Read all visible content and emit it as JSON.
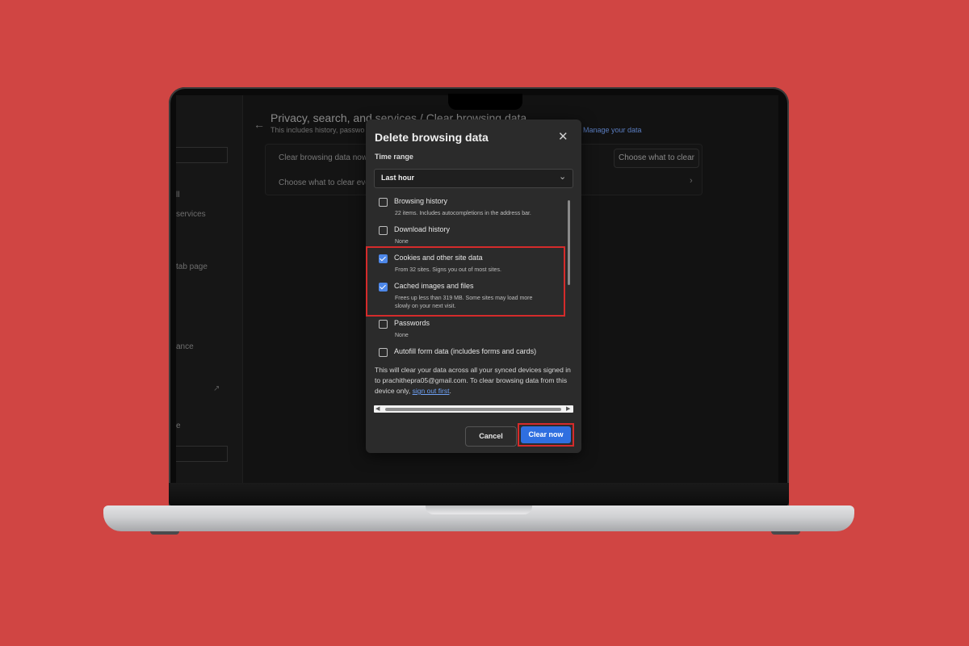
{
  "settings": {
    "page_title": "Privacy, search, and services / Clear browsing data",
    "page_subtitle": "This includes history, passwo",
    "manage_link": "Manage your data",
    "clear_now_row": "Clear browsing data now",
    "choose_every_row": "Choose what to clear ever",
    "choose_button": "Choose what to clear",
    "sidebar_items": [
      "ll",
      "services",
      "tab page",
      "ance",
      "e"
    ]
  },
  "dialog": {
    "title": "Delete browsing data",
    "time_range_label": "Time range",
    "time_range_value": "Last hour",
    "options": [
      {
        "label": "Browsing history",
        "desc": "22 items. Includes autocompletions in the address bar.",
        "checked": false
      },
      {
        "label": "Download history",
        "desc": "None",
        "checked": false
      },
      {
        "label": "Cookies and other site data",
        "desc": "From 32 sites. Signs you out of most sites.",
        "checked": true
      },
      {
        "label": "Cached images and files",
        "desc_line1": "Frees up less than 319 MB. Some sites may load more",
        "desc_line2": "slowly on your next visit.",
        "checked": true
      },
      {
        "label": "Passwords",
        "desc": "None",
        "checked": false
      },
      {
        "label": "Autofill form data (includes forms and cards)",
        "checked": false
      }
    ],
    "sync_note_prefix": "This will clear your data across all your synced devices signed in to prachithepra05@gmail.com. To clear browsing data from this device only,",
    "sync_note_link": "sign out first",
    "sync_note_suffix": ".",
    "cancel_label": "Cancel",
    "clear_label": "Clear now"
  },
  "colors": {
    "background": "#d04543",
    "accent": "#2f6fe0",
    "highlight": "#d52b2b"
  }
}
